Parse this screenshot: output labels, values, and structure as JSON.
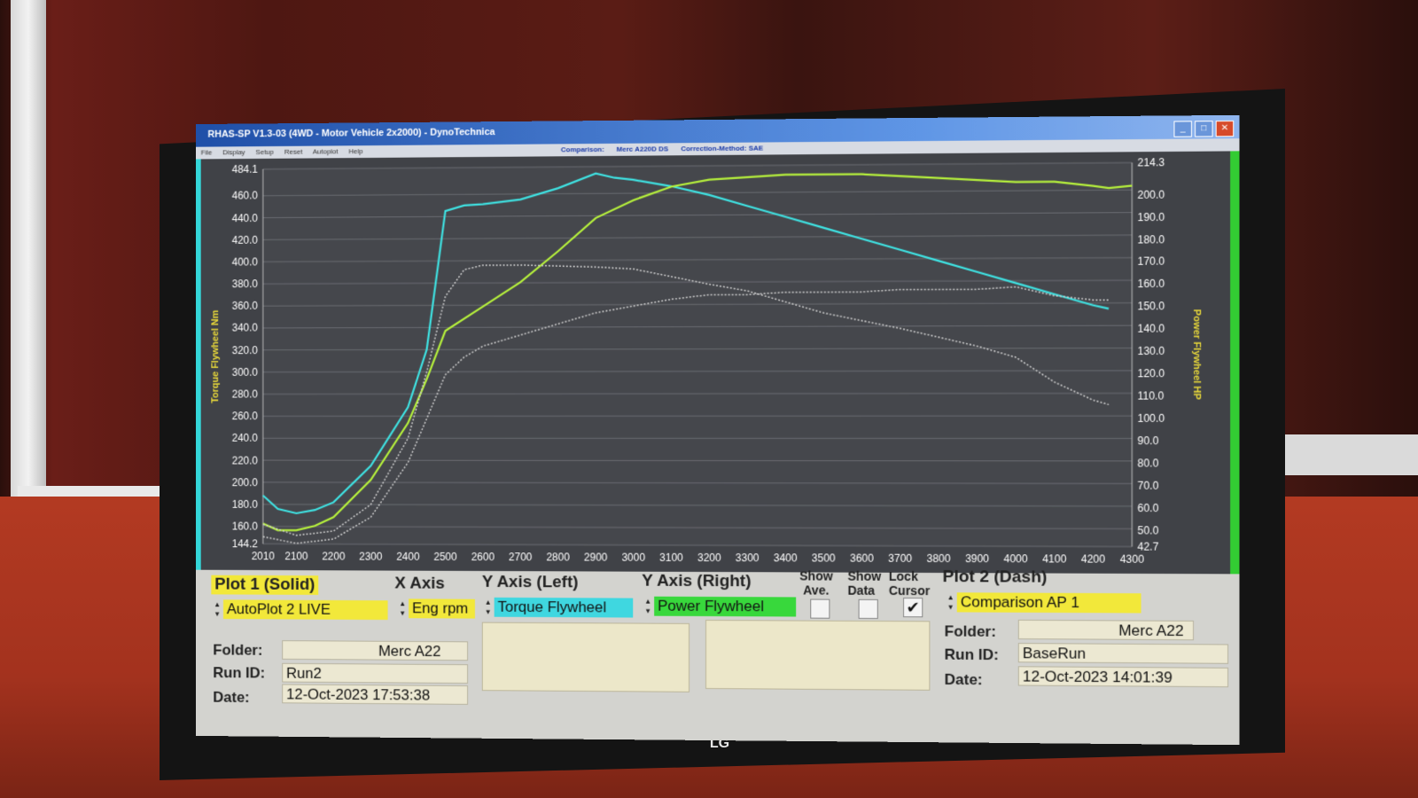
{
  "window": {
    "title": "RHAS-SP V1.3-03  (4WD - Motor Vehicle 2x2000) - DynoTechnica",
    "menu": [
      "File",
      "Display",
      "Setup",
      "Reset",
      "Autoplot",
      "Help"
    ],
    "comparison_label": "Comparison:",
    "comparison_name": "Merc A220D DS",
    "correction_method": "Correction-Method: SAE"
  },
  "panel": {
    "plot1": {
      "title": "Plot 1 (Solid)",
      "source": "AutoPlot 2 LIVE"
    },
    "x_axis": {
      "title": "X Axis",
      "value": "Eng rpm"
    },
    "y_left": {
      "title": "Y Axis (Left)",
      "value": "Torque Flywheel"
    },
    "y_right": {
      "title": "Y Axis (Right)",
      "value": "Power Flywheel"
    },
    "show_ave": {
      "label1": "Show",
      "label2": "Ave.",
      "checked": false
    },
    "show_data": {
      "label1": "Show",
      "label2": "Data",
      "checked": false
    },
    "lock_cursor": {
      "label1": "Lock",
      "label2": "Cursor",
      "checked": true,
      "mark": "✔"
    },
    "plot2": {
      "title": "Plot 2 (Dash)",
      "source": "Comparison AP 1"
    },
    "plot1_info": {
      "folder_label": "Folder:",
      "folder": "Merc A22",
      "runid_label": "Run ID:",
      "runid": "Run2",
      "date_label": "Date:",
      "date": "12-Oct-2023  17:53:38"
    },
    "plot2_info": {
      "folder_label": "Folder:",
      "folder": "Merc A22",
      "runid_label": "Run ID:",
      "runid": "BaseRun",
      "date_label": "Date:",
      "date": "12-Oct-2023  14:01:39"
    }
  },
  "brand": "LG",
  "chart_data": {
    "type": "line",
    "xlabel": "",
    "ylabel": "Torque Flywheel Nm",
    "y2label": "Power Flywheel HP",
    "xlim": [
      2010,
      4300
    ],
    "ylim": [
      144.2,
      484.1
    ],
    "y2lim": [
      42.7,
      214.3
    ],
    "x_ticks": [
      "2010",
      "2100",
      "2200",
      "2300",
      "2400",
      "2500",
      "2600",
      "2700",
      "2800",
      "2900",
      "3000",
      "3100",
      "3200",
      "3300",
      "3400",
      "3500",
      "3600",
      "3700",
      "3800",
      "3900",
      "4000",
      "4100",
      "4200",
      "4300"
    ],
    "y_ticks": [
      "484.1",
      "460.0",
      "440.0",
      "420.0",
      "400.0",
      "380.0",
      "360.0",
      "340.0",
      "320.0",
      "300.0",
      "280.0",
      "260.0",
      "240.0",
      "220.0",
      "200.0",
      "180.0",
      "160.0",
      "144.2"
    ],
    "y2_ticks": [
      "214.3",
      "200.0",
      "190.0",
      "180.0",
      "170.0",
      "160.0",
      "150.0",
      "140.0",
      "130.0",
      "120.0",
      "110.0",
      "100.0",
      "90.0",
      "80.0",
      "70.0",
      "60.0",
      "50.0",
      "42.7"
    ],
    "grid": true,
    "series": [
      {
        "color": "#3fe3e3",
        "style": "solid",
        "axis": "left",
        "x": [
          2010,
          2050,
          2100,
          2150,
          2200,
          2300,
          2400,
          2450,
          2500,
          2550,
          2600,
          2700,
          2800,
          2900,
          2950,
          3000,
          3100,
          3200,
          3300,
          3400,
          3500,
          3600,
          3700,
          3800,
          3900,
          4000,
          4100,
          4200,
          4240
        ],
        "y": [
          188,
          176,
          172,
          175,
          182,
          215,
          268,
          320,
          445,
          450,
          451,
          455,
          465,
          478,
          474,
          472,
          466,
          458,
          448,
          438,
          428,
          418,
          408,
          398,
          388,
          378,
          368,
          358,
          355
        ]
      },
      {
        "color": "#b7f23c",
        "style": "solid",
        "axis": "right",
        "x": [
          2010,
          2050,
          2100,
          2150,
          2200,
          2300,
          2400,
          2450,
          2500,
          2600,
          2700,
          2800,
          2900,
          3000,
          3100,
          3200,
          3300,
          3400,
          3500,
          3600,
          3700,
          3800,
          3900,
          4000,
          4100,
          4200,
          4240,
          4300
        ],
        "y": [
          52,
          49,
          49,
          51,
          55,
          72,
          98,
          118,
          140,
          151,
          162,
          176,
          191,
          199,
          205,
          208,
          209,
          210,
          210,
          210,
          209,
          208,
          207,
          206,
          206,
          204,
          203,
          204
        ]
      },
      {
        "color": "#d0d0d0",
        "style": "dashed",
        "axis": "left",
        "x": [
          2010,
          2100,
          2200,
          2300,
          2400,
          2450,
          2500,
          2550,
          2600,
          2700,
          2800,
          2900,
          3000,
          3100,
          3200,
          3300,
          3400,
          3500,
          3600,
          3700,
          3800,
          3900,
          4000,
          4100,
          4200,
          4240
        ],
        "y": [
          162,
          152,
          156,
          180,
          240,
          300,
          368,
          392,
          396,
          396,
          395,
          394,
          392,
          385,
          378,
          372,
          362,
          352,
          345,
          338,
          330,
          322,
          312,
          290,
          274,
          270
        ]
      },
      {
        "color": "#d0d0d0",
        "style": "dashed",
        "axis": "right",
        "x": [
          2010,
          2100,
          2200,
          2300,
          2400,
          2450,
          2500,
          2550,
          2600,
          2700,
          2800,
          2900,
          3000,
          3100,
          3200,
          3300,
          3400,
          3500,
          3600,
          3700,
          3800,
          3900,
          4000,
          4100,
          4200,
          4240
        ],
        "y": [
          46,
          43,
          45,
          55,
          80,
          100,
          120,
          128,
          133,
          138,
          143,
          148,
          151,
          154,
          156,
          156,
          157,
          157,
          157,
          158,
          158,
          158,
          159,
          155,
          153,
          153
        ]
      }
    ]
  }
}
